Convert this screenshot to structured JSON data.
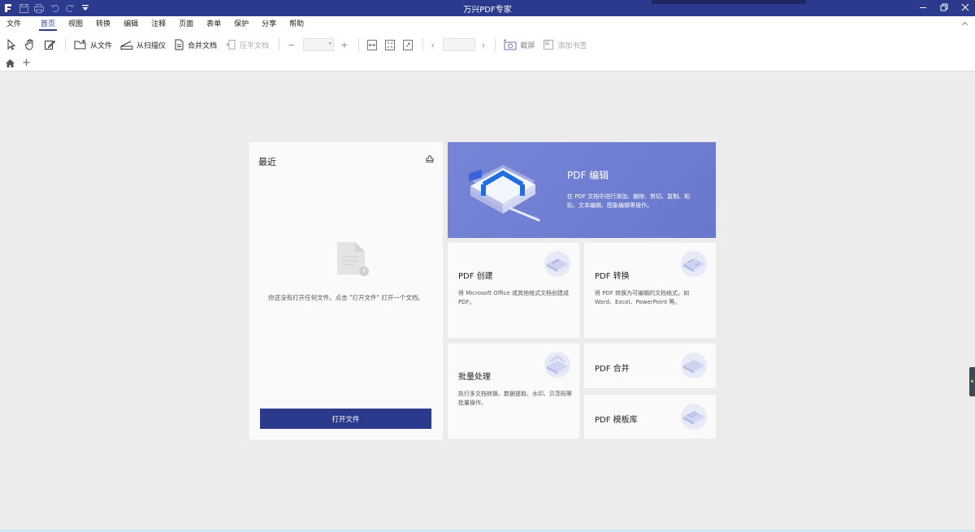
{
  "app": {
    "title": "万兴PDF专家"
  },
  "menu": {
    "items": [
      "文件",
      "首页",
      "视图",
      "转换",
      "编辑",
      "注释",
      "页面",
      "表单",
      "保护",
      "分享",
      "帮助"
    ],
    "active_index": 1
  },
  "toolbar": {
    "from_file": "从文件",
    "from_scanner": "从扫描仪",
    "merge_docs": "合并文档",
    "compress_docs": "压平文档",
    "zoom_out": "−",
    "zoom_in": "+",
    "prev_page": "‹",
    "next_page": "›",
    "screenshot": "截屏",
    "add_bookmark": "添加书签"
  },
  "recent": {
    "title": "最近",
    "empty_text": "你还没有打开任何文件。点击 \"打开文件\" 打开一个文档。",
    "open_button": "打开文件"
  },
  "cards": {
    "edit": {
      "title": "PDF 编辑",
      "desc": "在 PDF 文档中进行添加、删除、剪切、复制、粘贴、文本编辑、图象编辑等操作。"
    },
    "create": {
      "title": "PDF 创建",
      "desc": "将 Microsoft Office 或其他格式文档创建成 PDF。"
    },
    "convert": {
      "title": "PDF 转换",
      "desc": "将 PDF 转换为可编辑的文档格式，如 Word、Excel、PowerPoint 等。"
    },
    "batch": {
      "title": "批量处理",
      "desc": "执行多文档转换、数据提取、水印、贝茨码等批量操作。"
    },
    "merge": {
      "title": "PDF 合并"
    },
    "templates": {
      "title": "PDF 模板库"
    }
  },
  "colors": {
    "brand": "#2b3a8c",
    "hero": "#7483d4"
  }
}
